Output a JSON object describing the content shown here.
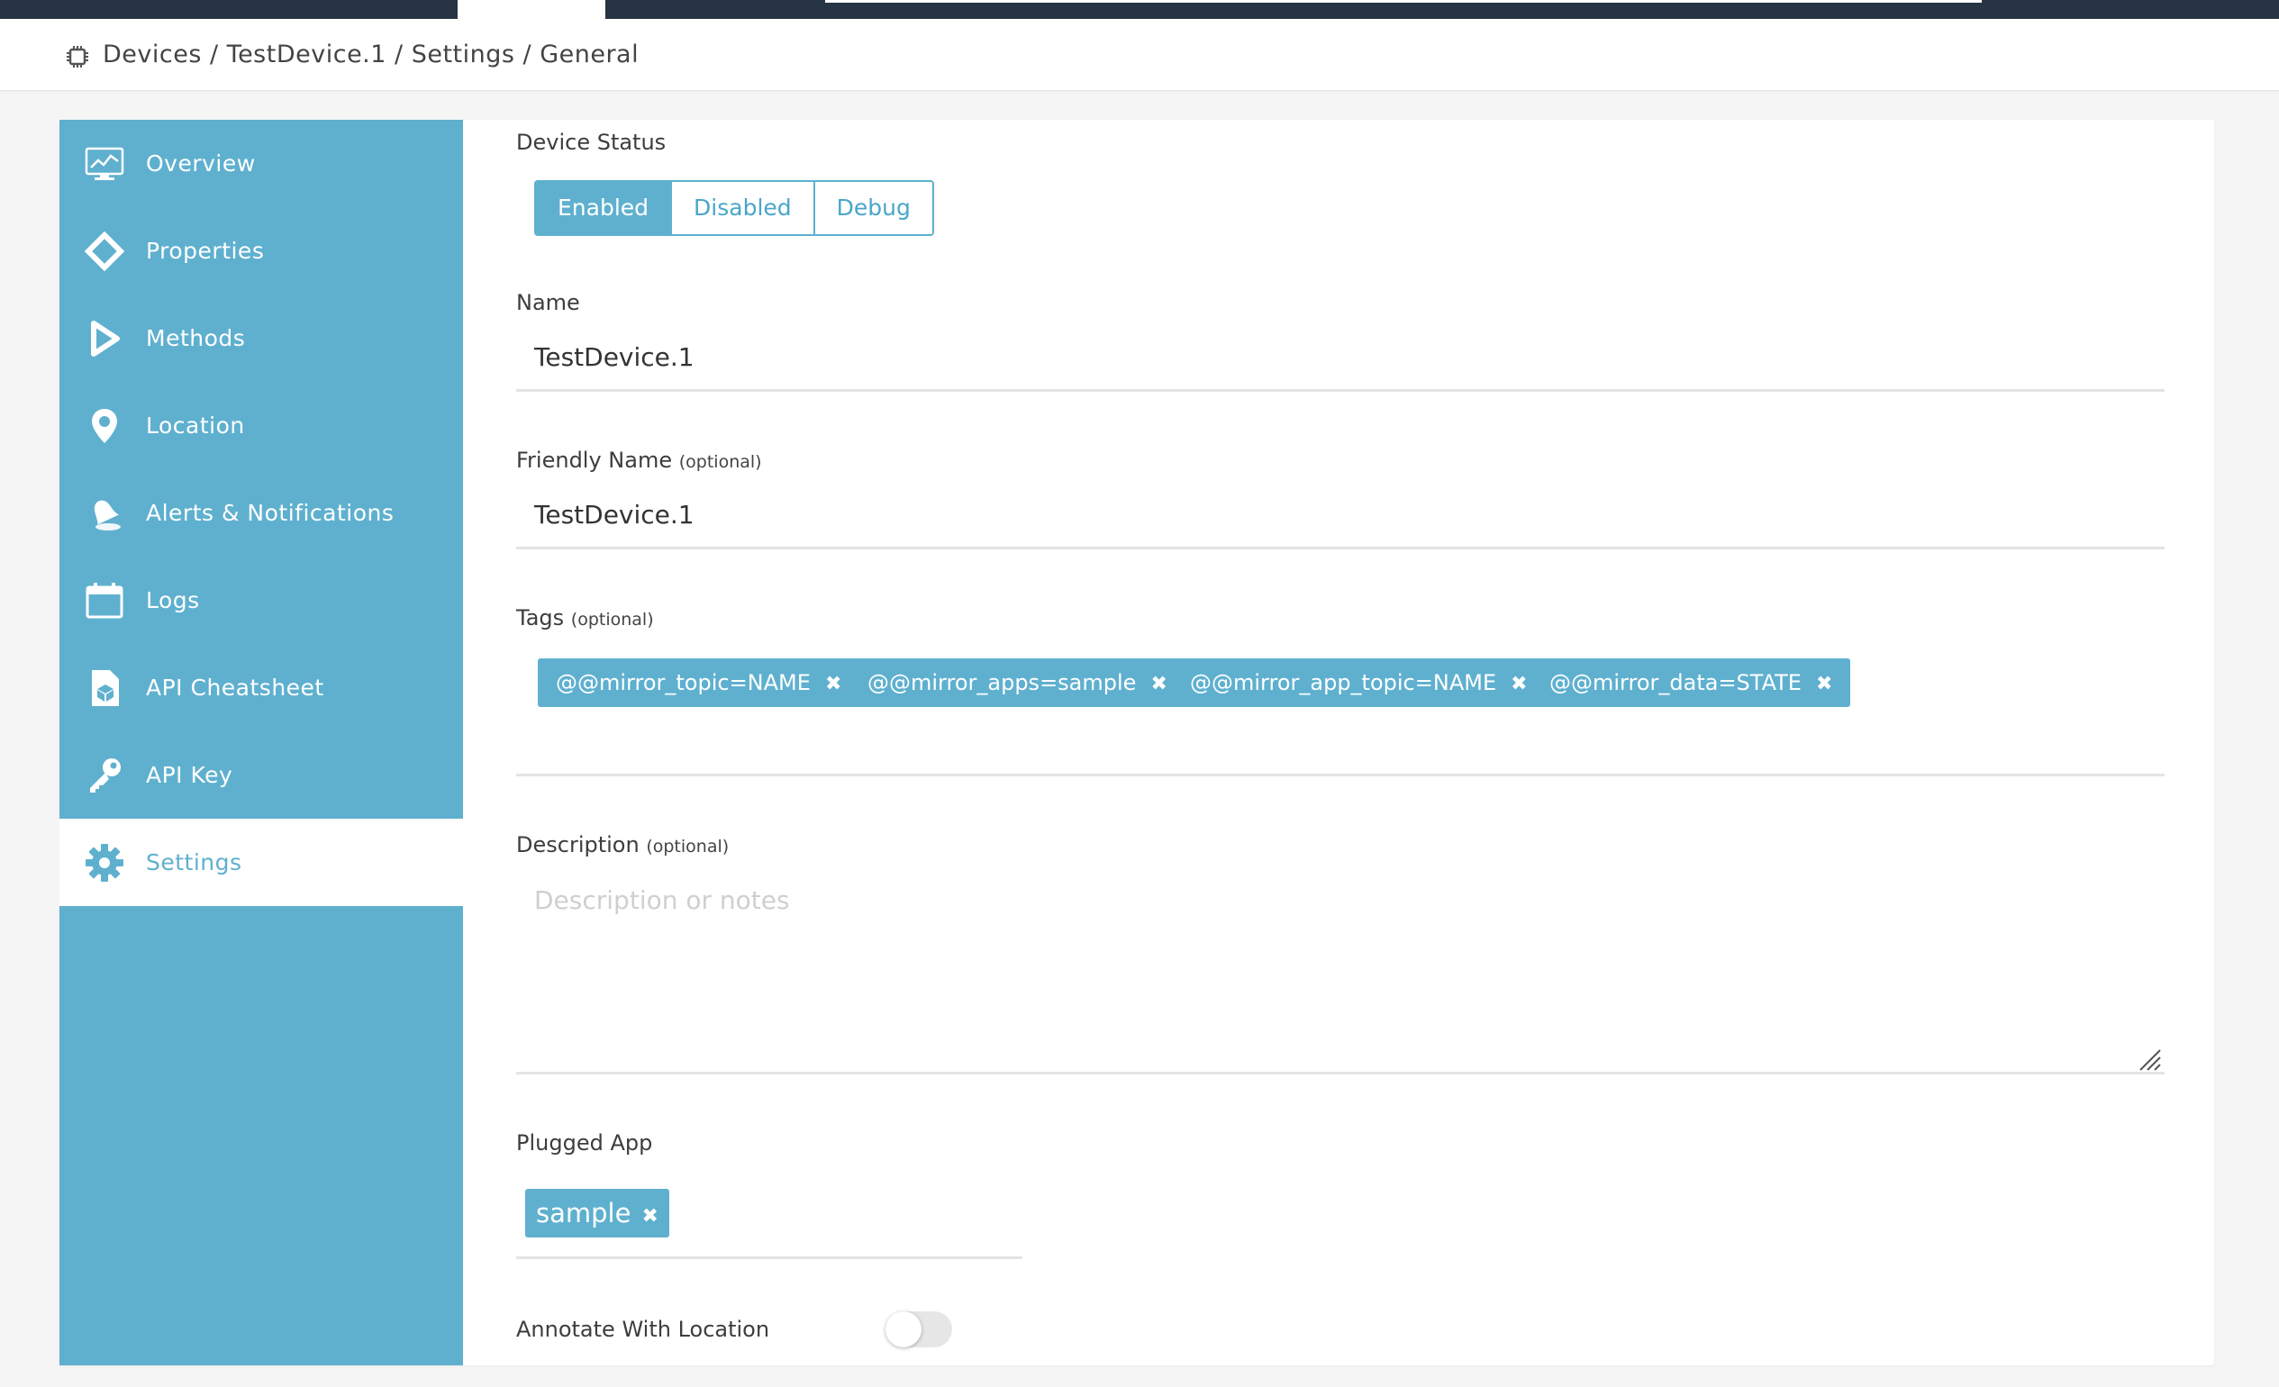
{
  "breadcrumb": {
    "icon": "chip-icon",
    "path": "Devices / TestDevice.1 / Settings / General"
  },
  "sidebar": {
    "items": [
      {
        "label": "Overview",
        "icon": "monitor-chart-icon"
      },
      {
        "label": "Properties",
        "icon": "diamond-icon"
      },
      {
        "label": "Methods",
        "icon": "play-icon"
      },
      {
        "label": "Location",
        "icon": "map-pin-icon"
      },
      {
        "label": "Alerts & Notifications",
        "icon": "bell-icon"
      },
      {
        "label": "Logs",
        "icon": "calendar-icon"
      },
      {
        "label": "API Cheatsheet",
        "icon": "document-cube-icon"
      },
      {
        "label": "API Key",
        "icon": "key-icon"
      },
      {
        "label": "Settings",
        "icon": "gear-icon",
        "active": true
      }
    ]
  },
  "form": {
    "device_status": {
      "label": "Device Status",
      "options": [
        "Enabled",
        "Disabled",
        "Debug"
      ],
      "selected": "Enabled"
    },
    "name": {
      "label": "Name",
      "value": "TestDevice.1"
    },
    "friendly_name": {
      "label": "Friendly Name",
      "optional": "(optional)",
      "value": "TestDevice.1"
    },
    "tags": {
      "label": "Tags",
      "optional": "(optional)",
      "items": [
        "@@mirror_topic=NAME",
        "@@mirror_apps=sample",
        "@@mirror_app_topic=NAME",
        "@@mirror_data=STATE"
      ],
      "remove_glyph": "✖"
    },
    "description": {
      "label": "Description",
      "optional": "(optional)",
      "placeholder": "Description or notes",
      "value": ""
    },
    "plugged_app": {
      "label": "Plugged App",
      "value": "sample",
      "remove_glyph": "✖"
    },
    "annotate_location": {
      "label": "Annotate With Location",
      "enabled": false
    }
  },
  "colors": {
    "accent": "#5fb0cf",
    "topbar": "#263443"
  }
}
